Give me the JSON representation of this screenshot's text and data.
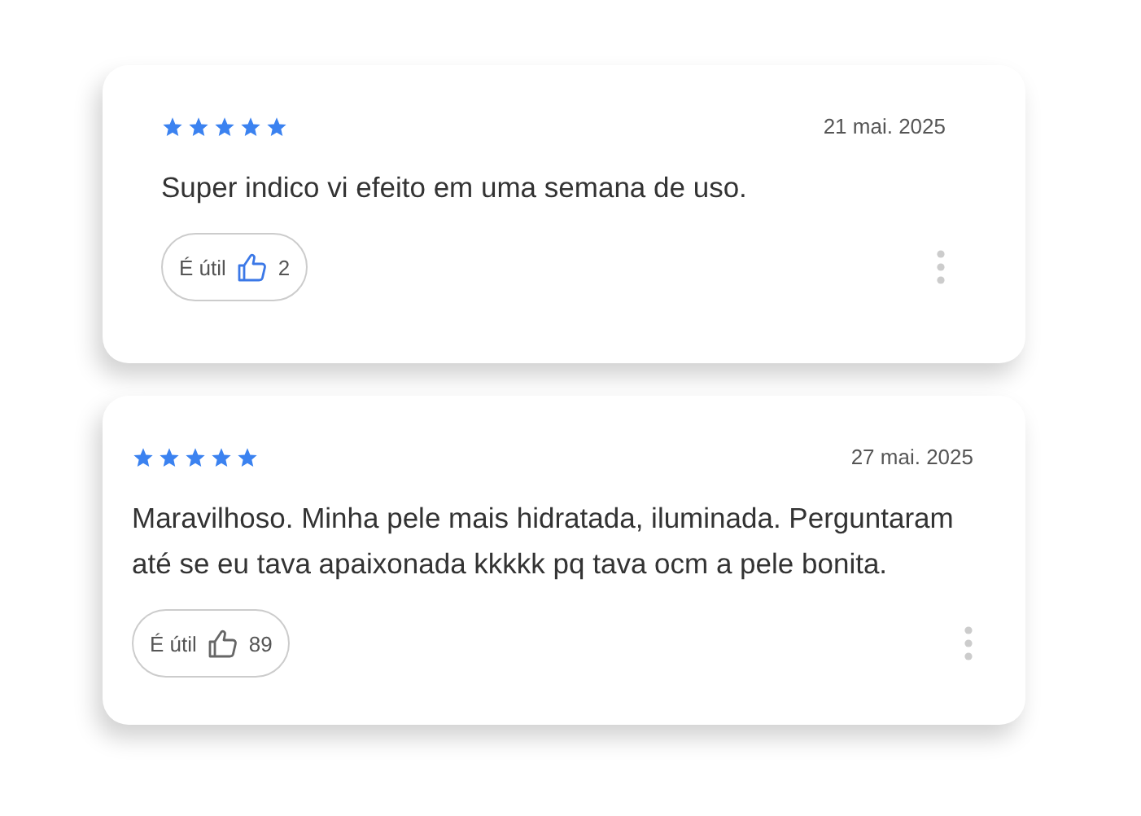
{
  "reviews": [
    {
      "stars": 5,
      "date": "21 mai. 2025",
      "text": "Super indico vi efeito em uma semana de uso.",
      "helpful_label": "É útil",
      "helpful_count": "2",
      "voted": true
    },
    {
      "stars": 5,
      "date": "27 mai. 2025",
      "text": "Maravilhoso. Minha pele mais hidratada, iluminada. Perguntaram até se eu tava apaixonada kkkkk pq tava ocm a pele bonita.",
      "helpful_label": "É útil",
      "helpful_count": "89",
      "voted": false
    }
  ]
}
